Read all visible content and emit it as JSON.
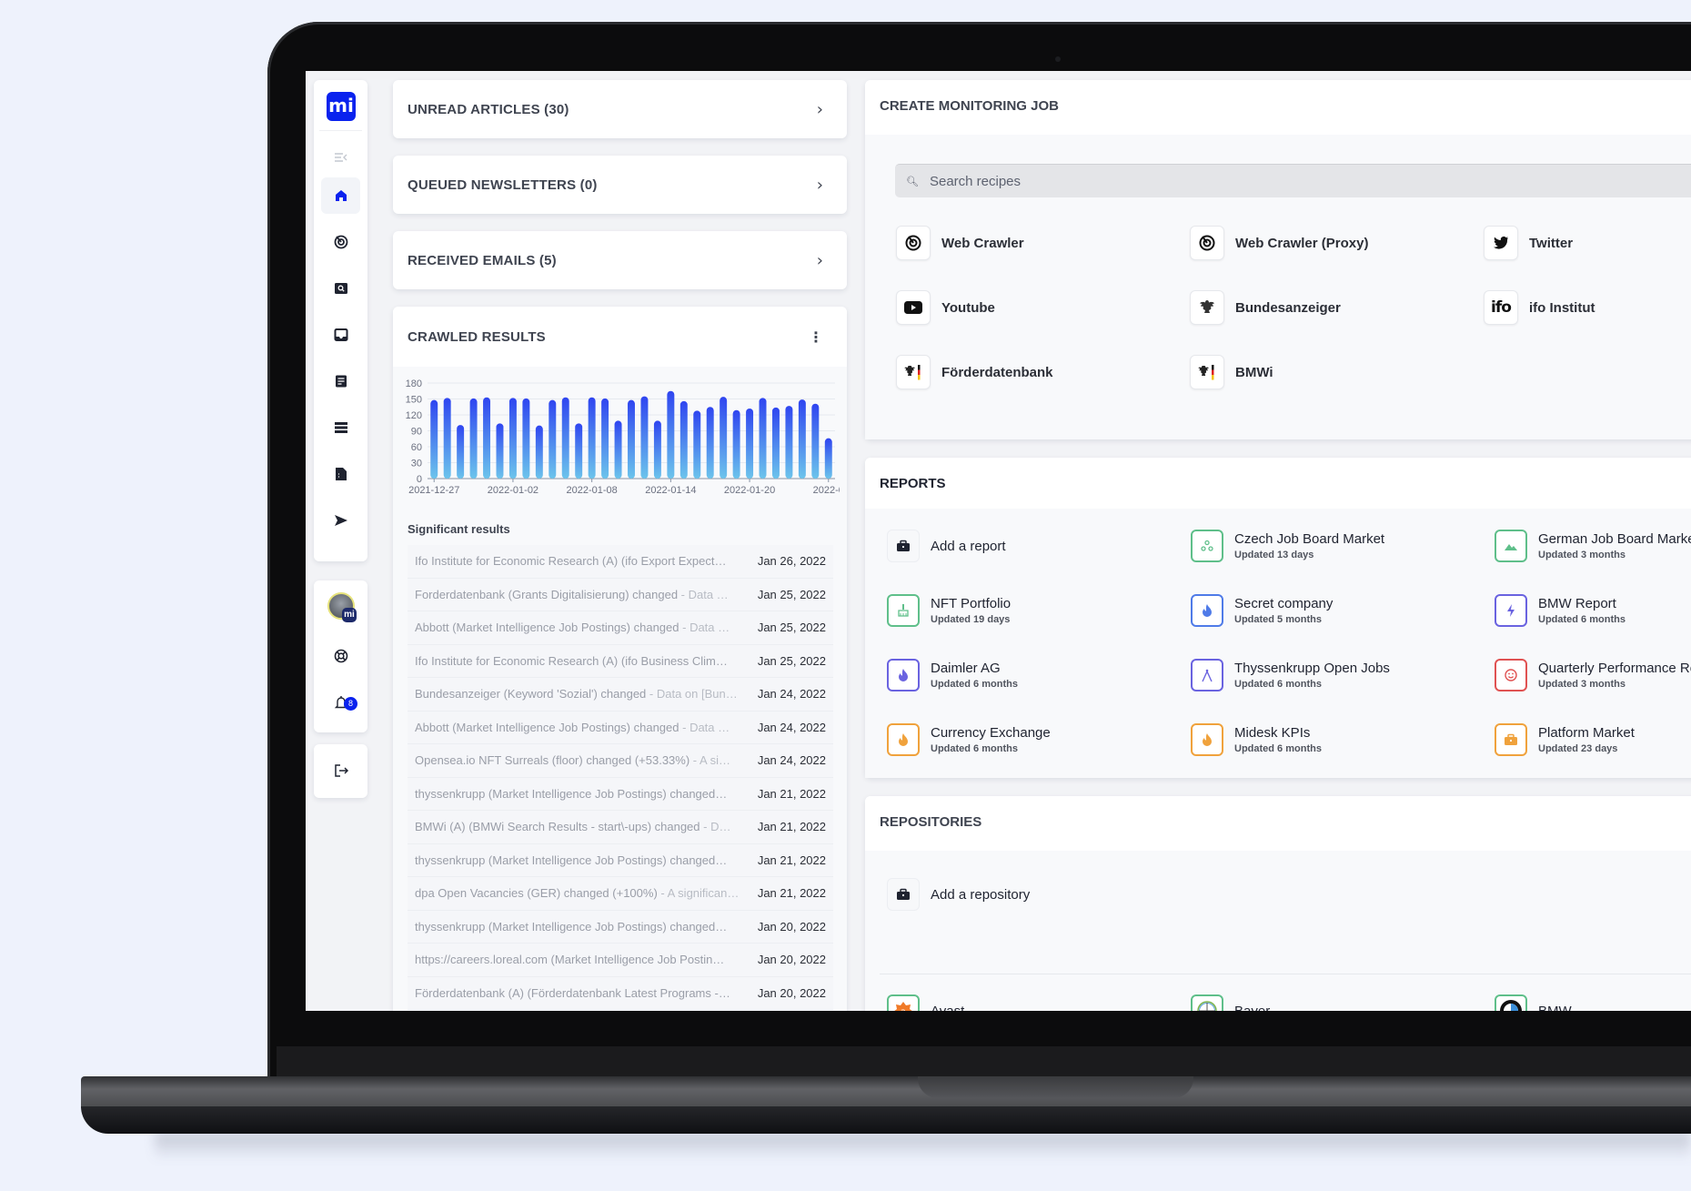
{
  "sidebar": {
    "logo": "mi",
    "items": [
      {
        "name": "collapse-menu",
        "icon": "menu-collapse-icon"
      },
      {
        "name": "home",
        "icon": "home-icon",
        "active": true
      },
      {
        "name": "monitoring",
        "icon": "radar-icon"
      },
      {
        "name": "search",
        "icon": "search-box-icon"
      },
      {
        "name": "inbox",
        "icon": "inbox-icon"
      },
      {
        "name": "articles",
        "icon": "document-icon"
      },
      {
        "name": "lists",
        "icon": "list-icon"
      },
      {
        "name": "files",
        "icon": "file-icon"
      },
      {
        "name": "send",
        "icon": "send-icon"
      }
    ],
    "avatar_badge": "mi",
    "notifications_count": "8"
  },
  "middle": {
    "unread": {
      "title": "UNREAD ARTICLES (30)"
    },
    "queued": {
      "title": "QUEUED NEWSLETTERS (0)"
    },
    "received": {
      "title": "RECEIVED EMAILS (5)"
    },
    "crawled": {
      "title": "CRAWLED RESULTS"
    },
    "significant_title": "Significant results",
    "significant": [
      {
        "text": "Ifo Institute for Economic Research (A) (ifo Export Expect…",
        "sub": "",
        "date": "Jan 26, 2022"
      },
      {
        "text": "Forderdatenbank (Grants Digitalisierung) changed",
        "sub": " - Data …",
        "date": "Jan 25, 2022"
      },
      {
        "text": "Abbott (Market Intelligence Job Postings) changed",
        "sub": " - Data …",
        "date": "Jan 25, 2022"
      },
      {
        "text": "Ifo Institute for Economic Research (A) (ifo Business Clim…",
        "sub": "",
        "date": "Jan 25, 2022"
      },
      {
        "text": "Bundesanzeiger (Keyword 'Sozial') changed",
        "sub": " - Data on [Bun…",
        "date": "Jan 24, 2022"
      },
      {
        "text": "Abbott (Market Intelligence Job Postings) changed",
        "sub": " - Data …",
        "date": "Jan 24, 2022"
      },
      {
        "text": "Opensea.io NFT Surreals (floor) changed (+53.33%)",
        "sub": " - A si…",
        "date": "Jan 24, 2022"
      },
      {
        "text": "thyssenkrupp (Market Intelligence Job Postings) changed…",
        "sub": "",
        "date": "Jan 21, 2022"
      },
      {
        "text": "BMWi (A) (BMWi Search Results - start\\-ups) changed",
        "sub": " - D…",
        "date": "Jan 21, 2022"
      },
      {
        "text": "thyssenkrupp (Market Intelligence Job Postings) changed…",
        "sub": "",
        "date": "Jan 21, 2022"
      },
      {
        "text": "dpa Open Vacancies (GER) changed (+100%)",
        "sub": " - A significan…",
        "date": "Jan 21, 2022"
      },
      {
        "text": "thyssenkrupp (Market Intelligence Job Postings) changed…",
        "sub": "",
        "date": "Jan 20, 2022"
      },
      {
        "text": "https://careers.loreal.com (Market Intelligence Job Postin…",
        "sub": "",
        "date": "Jan 20, 2022"
      },
      {
        "text": "Förderdatenbank (A) (Förderdatenbank Latest Programs -…",
        "sub": "",
        "date": "Jan 20, 2022"
      }
    ]
  },
  "chart_data": {
    "type": "bar",
    "title": "CRAWLED RESULTS",
    "xlabel": "",
    "ylabel": "",
    "ylim": [
      0,
      180
    ],
    "yticks": [
      0,
      30,
      60,
      90,
      120,
      150,
      180
    ],
    "xtick_labels": [
      "2021-12-27",
      "2022-01-02",
      "2022-01-08",
      "2022-01-14",
      "2022-01-20",
      "2022-0"
    ],
    "xtick_every": 6,
    "grid": true,
    "categories": [
      "2021-12-27",
      "2021-12-28",
      "2021-12-29",
      "2021-12-30",
      "2021-12-31",
      "2022-01-01",
      "2022-01-02",
      "2022-01-03",
      "2022-01-04",
      "2022-01-05",
      "2022-01-06",
      "2022-01-07",
      "2022-01-08",
      "2022-01-09",
      "2022-01-10",
      "2022-01-11",
      "2022-01-12",
      "2022-01-13",
      "2022-01-14",
      "2022-01-15",
      "2022-01-16",
      "2022-01-17",
      "2022-01-18",
      "2022-01-19",
      "2022-01-20",
      "2022-01-21",
      "2022-01-22",
      "2022-01-23",
      "2022-01-24",
      "2022-01-25",
      "2022-01-26"
    ],
    "values": [
      148,
      152,
      101,
      151,
      153,
      104,
      152,
      151,
      100,
      148,
      153,
      104,
      153,
      151,
      109,
      148,
      155,
      109,
      165,
      146,
      128,
      135,
      154,
      129,
      132,
      152,
      134,
      137,
      149,
      141,
      76
    ],
    "colors": {
      "top": "#2f45f0",
      "bottom": "#6cc4ec"
    }
  },
  "monitoring": {
    "title": "CREATE MONITORING JOB",
    "search_placeholder": "Search recipes",
    "recipes": [
      {
        "label": "Web Crawler",
        "icon": "radar-icon"
      },
      {
        "label": "Web Crawler (Proxy)",
        "icon": "radar-icon"
      },
      {
        "label": "Twitter",
        "icon": "twitter-icon"
      },
      {
        "label": "Youtube",
        "icon": "youtube-icon"
      },
      {
        "label": "Bundesanzeiger",
        "icon": "eagle-icon"
      },
      {
        "label": "ifo Institut",
        "icon": "ifo-logo-icon"
      },
      {
        "label": "Förderdatenbank",
        "icon": "eagle-flag-icon"
      },
      {
        "label": "BMWi",
        "icon": "eagle-flag-icon"
      }
    ]
  },
  "reports": {
    "title": "REPORTS",
    "add_label": "Add a report",
    "items": [
      {
        "name": "Czech Job Board Market",
        "updated": "Updated 13 days",
        "icon": "circles-icon",
        "color": "#5fbf8a"
      },
      {
        "name": "German Job Board Market",
        "updated": "Updated 3 months",
        "icon": "mountain-icon",
        "color": "#5fbf8a"
      },
      {
        "name": "NFT Portfolio",
        "updated": "Updated 19 days",
        "icon": "brush-icon",
        "color": "#5fbf8a"
      },
      {
        "name": "Secret company",
        "updated": "Updated 5 months",
        "icon": "flame-icon",
        "color": "#4f7be8"
      },
      {
        "name": "BMW Report",
        "updated": "Updated 6 months",
        "icon": "bolt-icon",
        "color": "#6a63e0"
      },
      {
        "name": "Daimler AG",
        "updated": "Updated 6 months",
        "icon": "flame-icon",
        "color": "#6a63e0"
      },
      {
        "name": "Thyssenkrupp Open Jobs",
        "updated": "Updated 6 months",
        "icon": "compass-icon",
        "color": "#6a63e0"
      },
      {
        "name": "Quarterly Performance Report",
        "updated": "Updated 3 months",
        "icon": "smile-icon",
        "color": "#e05252"
      },
      {
        "name": "Currency Exchange",
        "updated": "Updated 6 months",
        "icon": "flame-icon",
        "color": "#f0a23c"
      },
      {
        "name": "Midesk KPIs",
        "updated": "Updated 6 months",
        "icon": "flame-icon",
        "color": "#f0a23c"
      },
      {
        "name": "Platform Market",
        "updated": "Updated 23 days",
        "icon": "briefcase-icon",
        "color": "#f0a23c"
      }
    ]
  },
  "repositories": {
    "title": "REPOSITORIES",
    "add_label": "Add a repository",
    "items": [
      {
        "name": "Avast",
        "icon": "avast-logo-icon"
      },
      {
        "name": "Bayer",
        "icon": "bayer-logo-icon"
      },
      {
        "name": "BMW",
        "icon": "bmw-logo-icon"
      }
    ]
  }
}
